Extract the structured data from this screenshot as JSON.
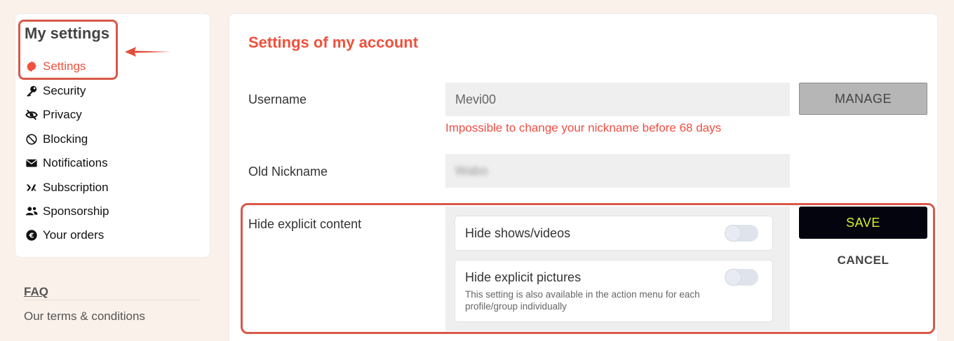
{
  "sidebar": {
    "title": "My settings",
    "items": [
      {
        "label": "Settings",
        "icon": "gear-icon",
        "active": true
      },
      {
        "label": "Security",
        "icon": "key-icon"
      },
      {
        "label": "Privacy",
        "icon": "eye-slash-icon"
      },
      {
        "label": "Blocking",
        "icon": "block-icon"
      },
      {
        "label": "Notifications",
        "icon": "envelope-icon"
      },
      {
        "label": "Subscription",
        "icon": "brand-logo-icon"
      },
      {
        "label": "Sponsorship",
        "icon": "users-icon"
      },
      {
        "label": "Your orders",
        "icon": "euro-icon"
      }
    ],
    "faq": "FAQ",
    "terms": "Our terms & conditions"
  },
  "main": {
    "title": "Settings of my account",
    "username": {
      "label": "Username",
      "value": "Mevi00",
      "manage": "MANAGE",
      "error": "Impossible to change your nickname before 68 days"
    },
    "old_nickname": {
      "label": "Old Nickname",
      "value": "Wabo"
    },
    "explicit": {
      "label": "Hide explicit content",
      "shows": {
        "label": "Hide shows/videos",
        "enabled": false
      },
      "pictures": {
        "label": "Hide explicit pictures",
        "description": "This setting is also available in the action menu for each profile/group individually",
        "enabled": false
      }
    },
    "save": "SAVE",
    "cancel": "CANCEL"
  },
  "colors": {
    "accent": "#f0503c",
    "highlight": "#d9584a",
    "save_bg": "#04040f",
    "save_text": "#d7ef2a"
  }
}
